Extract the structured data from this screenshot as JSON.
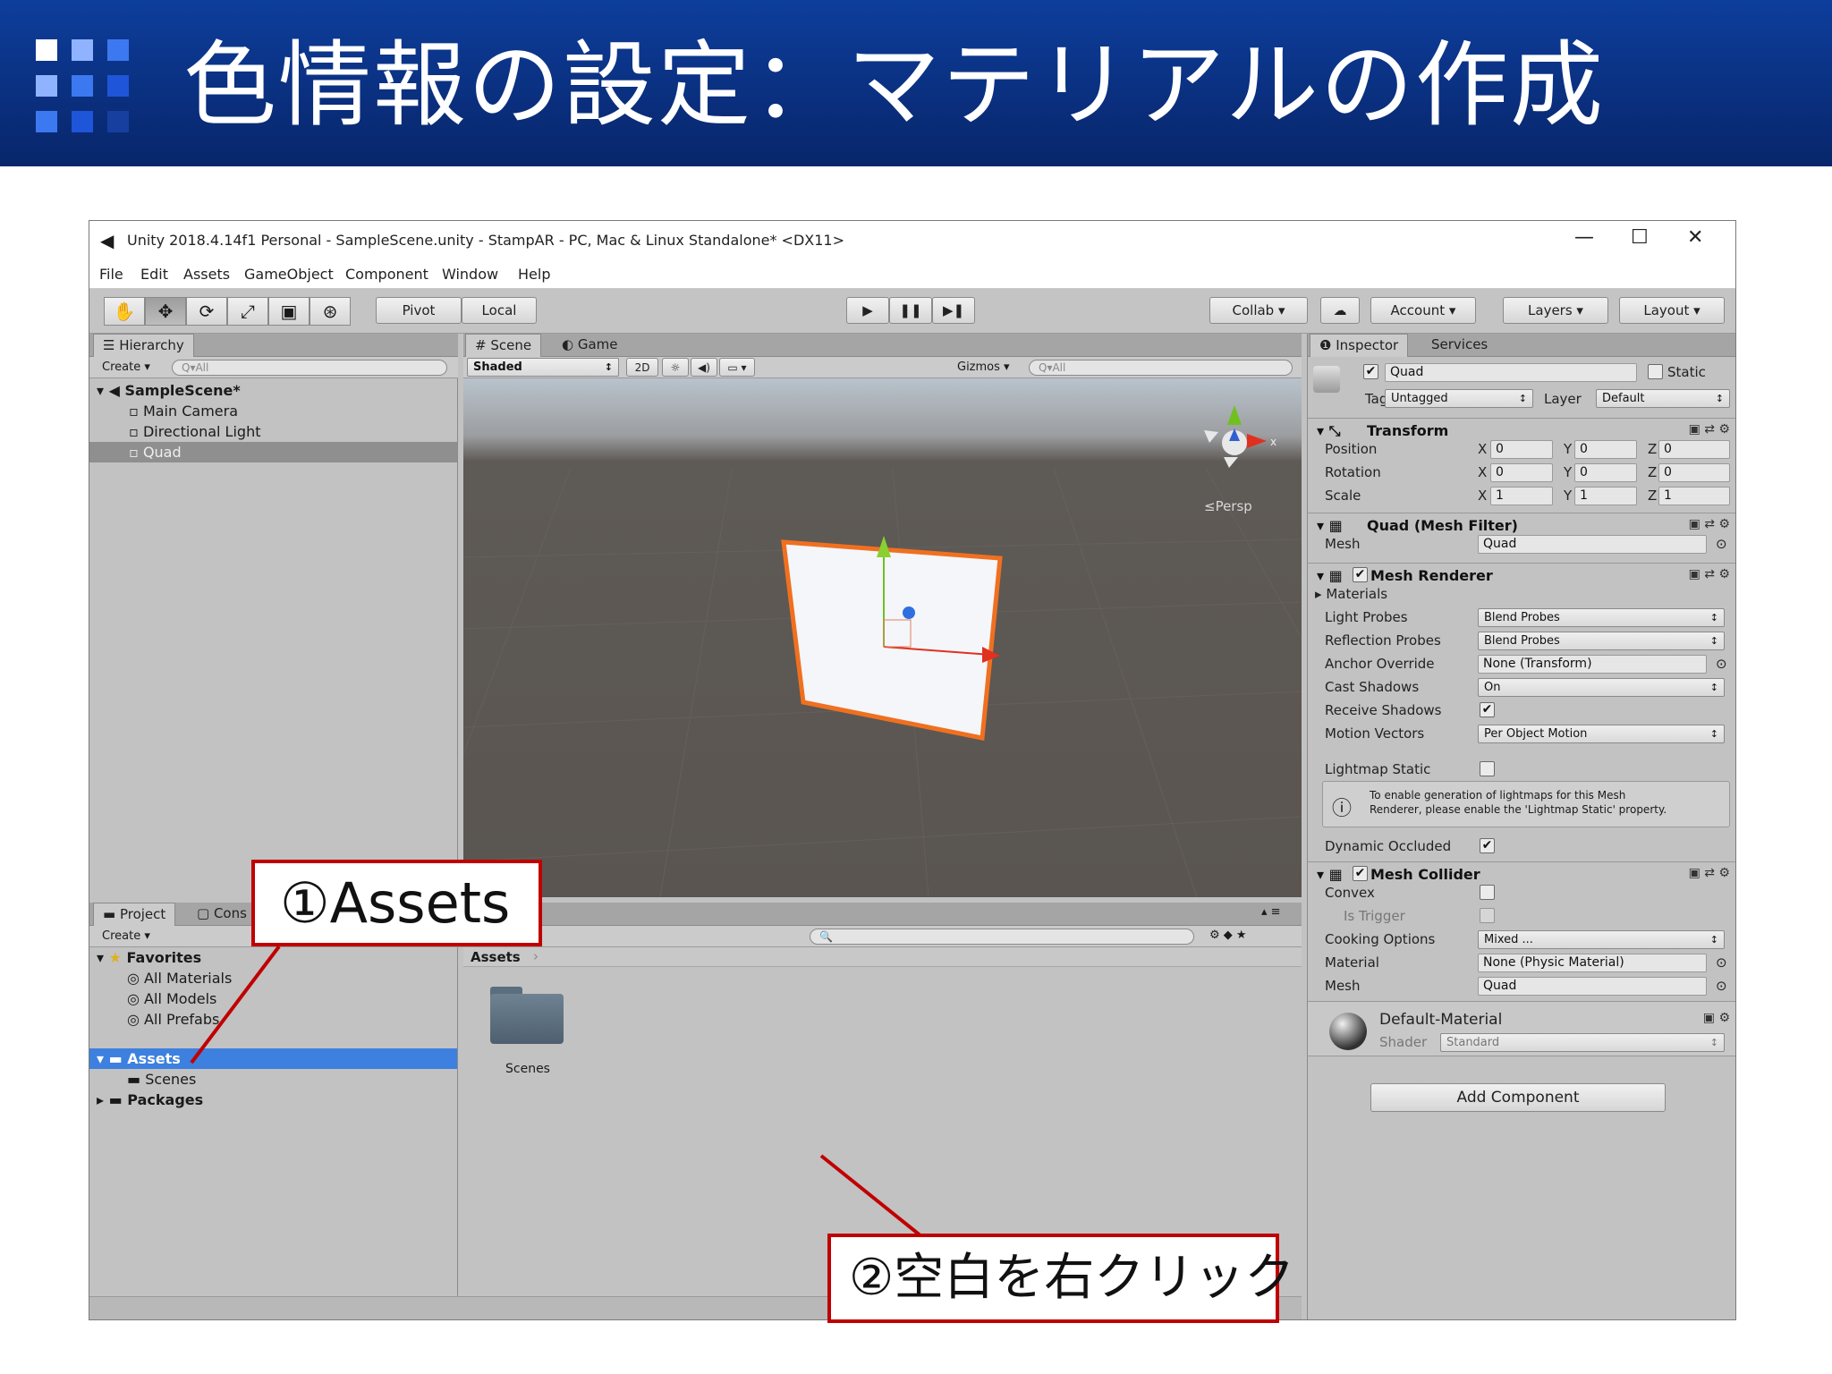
{
  "slide": {
    "title": "色情報の設定：マテリアルの作成"
  },
  "window": {
    "title": "Unity 2018.4.14f1 Personal - SampleScene.unity - StampAR - PC, Mac & Linux Standalone* <DX11>",
    "minimize": "—",
    "maximize": "☐",
    "close": "✕"
  },
  "menu": [
    "File",
    "Edit",
    "Assets",
    "GameObject",
    "Component",
    "Window",
    "Help"
  ],
  "toolbar": {
    "tools": [
      "✋",
      "✥",
      "⟳",
      "⤢",
      "▣",
      "⊛"
    ],
    "pivot": "Pivot",
    "local": "Local",
    "play": "▶",
    "pause": "❚❚",
    "step": "▶❚",
    "collab": "Collab ▾",
    "cloud": "☁",
    "account": "Account",
    "layers": "Layers",
    "layout": "Layout"
  },
  "hierarchy": {
    "tab": "Hierarchy",
    "create": "Create ▾",
    "search": "Q▾All",
    "scene": "SampleScene*",
    "items": [
      "Main Camera",
      "Directional Light",
      "Quad"
    ]
  },
  "scene": {
    "tab_scene": "Scene",
    "tab_game": "Game",
    "shading": "Shaded",
    "mode_2d": "2D",
    "gizmos": "Gizmos ▾",
    "search": "Q▾All",
    "persp": "≤Persp",
    "gizmo_x": "x"
  },
  "project": {
    "tab_project": "Project",
    "tab_console": "Cons",
    "create": "Create ▾",
    "favorites": "Favorites",
    "fav_items": [
      "All Materials",
      "All Models",
      "All Prefabs"
    ],
    "assets": "Assets",
    "scenes": "Scenes",
    "packages": "Packages",
    "breadcrumb": "Assets",
    "folder_label": "Scenes"
  },
  "inspector": {
    "tab_inspector": "Inspector",
    "tab_services": "Services",
    "object_name": "Quad",
    "static_label": "Static",
    "tag_label": "Tag",
    "tag_value": "Untagged",
    "layer_label": "Layer",
    "layer_value": "Default",
    "transform": {
      "title": "Transform",
      "rows": [
        {
          "label": "Position",
          "x": "0",
          "y": "0",
          "z": "0"
        },
        {
          "label": "Rotation",
          "x": "0",
          "y": "0",
          "z": "0"
        },
        {
          "label": "Scale",
          "x": "1",
          "y": "1",
          "z": "1"
        }
      ]
    },
    "mesh_filter": {
      "title": "Quad (Mesh Filter)",
      "mesh_label": "Mesh",
      "mesh_value": "Quad"
    },
    "mesh_renderer": {
      "title": "Mesh Renderer",
      "materials": "Materials",
      "light_probes_label": "Light Probes",
      "light_probes_value": "Blend Probes",
      "reflection_label": "Reflection Probes",
      "reflection_value": "Blend Probes",
      "anchor_label": "Anchor Override",
      "anchor_value": "None (Transform)",
      "cast_label": "Cast Shadows",
      "cast_value": "On",
      "receive_label": "Receive Shadows",
      "motion_label": "Motion Vectors",
      "motion_value": "Per Object Motion",
      "lightmap_label": "Lightmap Static",
      "info_line1": "To enable generation of lightmaps for this Mesh",
      "info_line2": "Renderer, please enable the 'Lightmap Static' property.",
      "dynamic_label": "Dynamic Occluded"
    },
    "mesh_collider": {
      "title": "Mesh Collider",
      "convex_label": "Convex",
      "trigger_label": "Is Trigger",
      "cooking_label": "Cooking Options",
      "cooking_value": "Mixed ...",
      "material_label": "Material",
      "material_value": "None (Physic Material)",
      "mesh_label": "Mesh",
      "mesh_value": "Quad"
    },
    "material": {
      "name": "Default-Material",
      "shader_label": "Shader",
      "shader_value": "Standard"
    },
    "add_component": "Add Component"
  },
  "callouts": {
    "first": "①Assets",
    "second": "②空白を右クリック"
  },
  "colors": {
    "banner": "#0a2f7e",
    "callout_border": "#c00000",
    "selection_blue": "#3d80df",
    "quad_outline": "#f07020"
  }
}
